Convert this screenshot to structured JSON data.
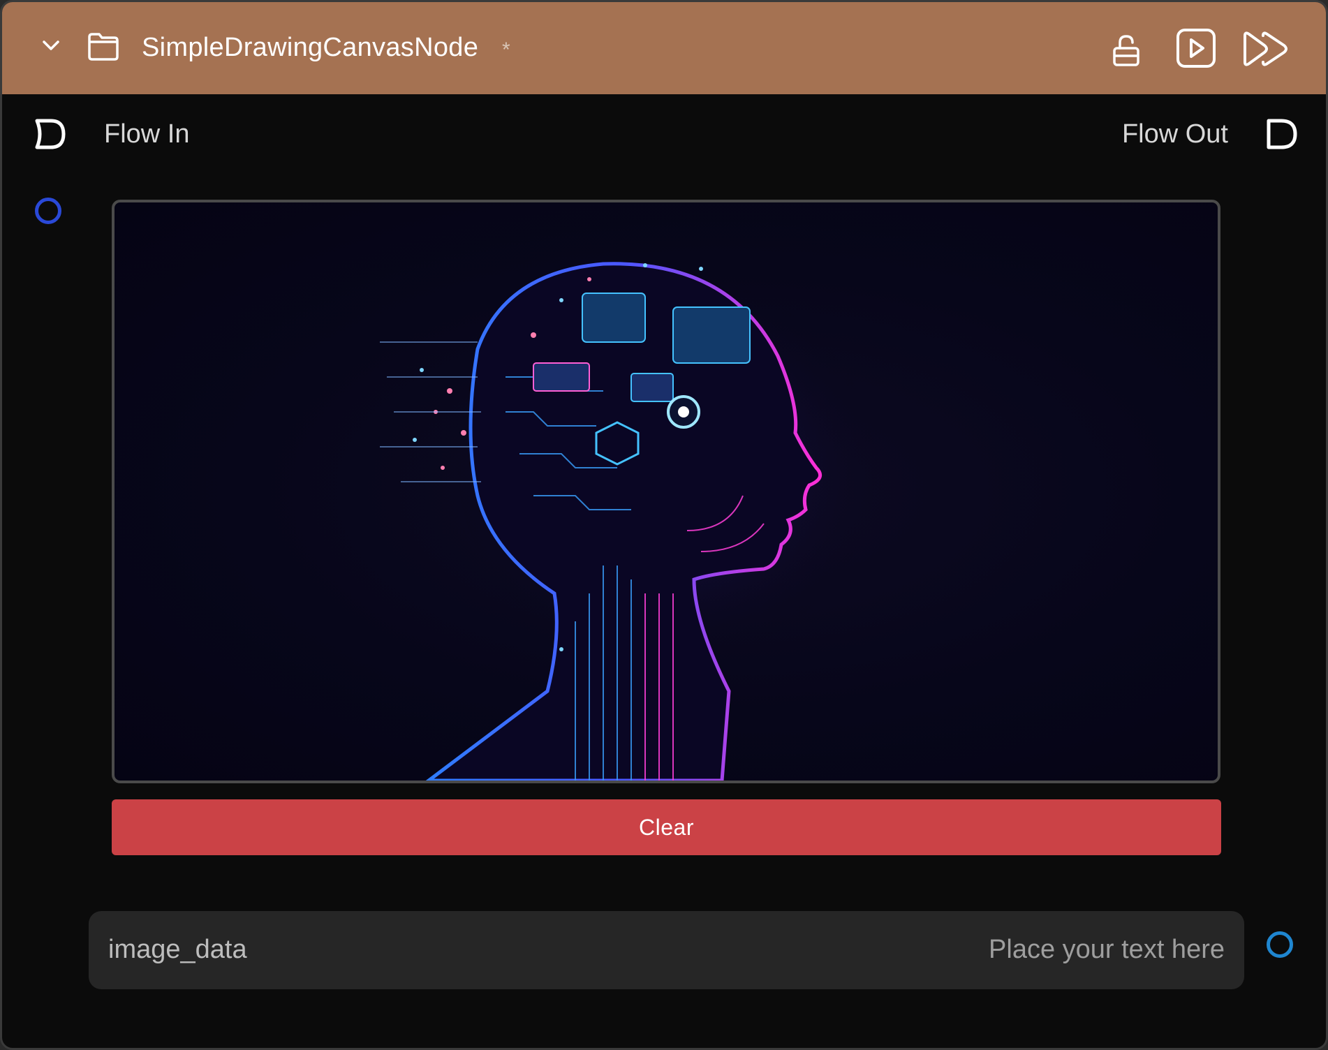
{
  "header": {
    "title": "SimpleDrawingCanvasNode",
    "modified_marker": "*",
    "icons": {
      "collapse": "chevron-down-icon",
      "folder": "folder-icon",
      "lock": "unlock-icon",
      "run": "play-icon",
      "run_all": "fast-forward-icon"
    },
    "color": "#a57252"
  },
  "flow": {
    "in_label": "Flow In",
    "out_label": "Flow Out"
  },
  "canvas": {
    "content": "ai-head-circuit-image"
  },
  "clear_button": {
    "label": "Clear",
    "color": "#cb4246"
  },
  "text_field": {
    "label": "image_data",
    "placeholder": "Place your text here"
  },
  "colors": {
    "background": "#0b0b0b",
    "input_port": "#2a49d8",
    "output_port": "#1f86d0"
  }
}
